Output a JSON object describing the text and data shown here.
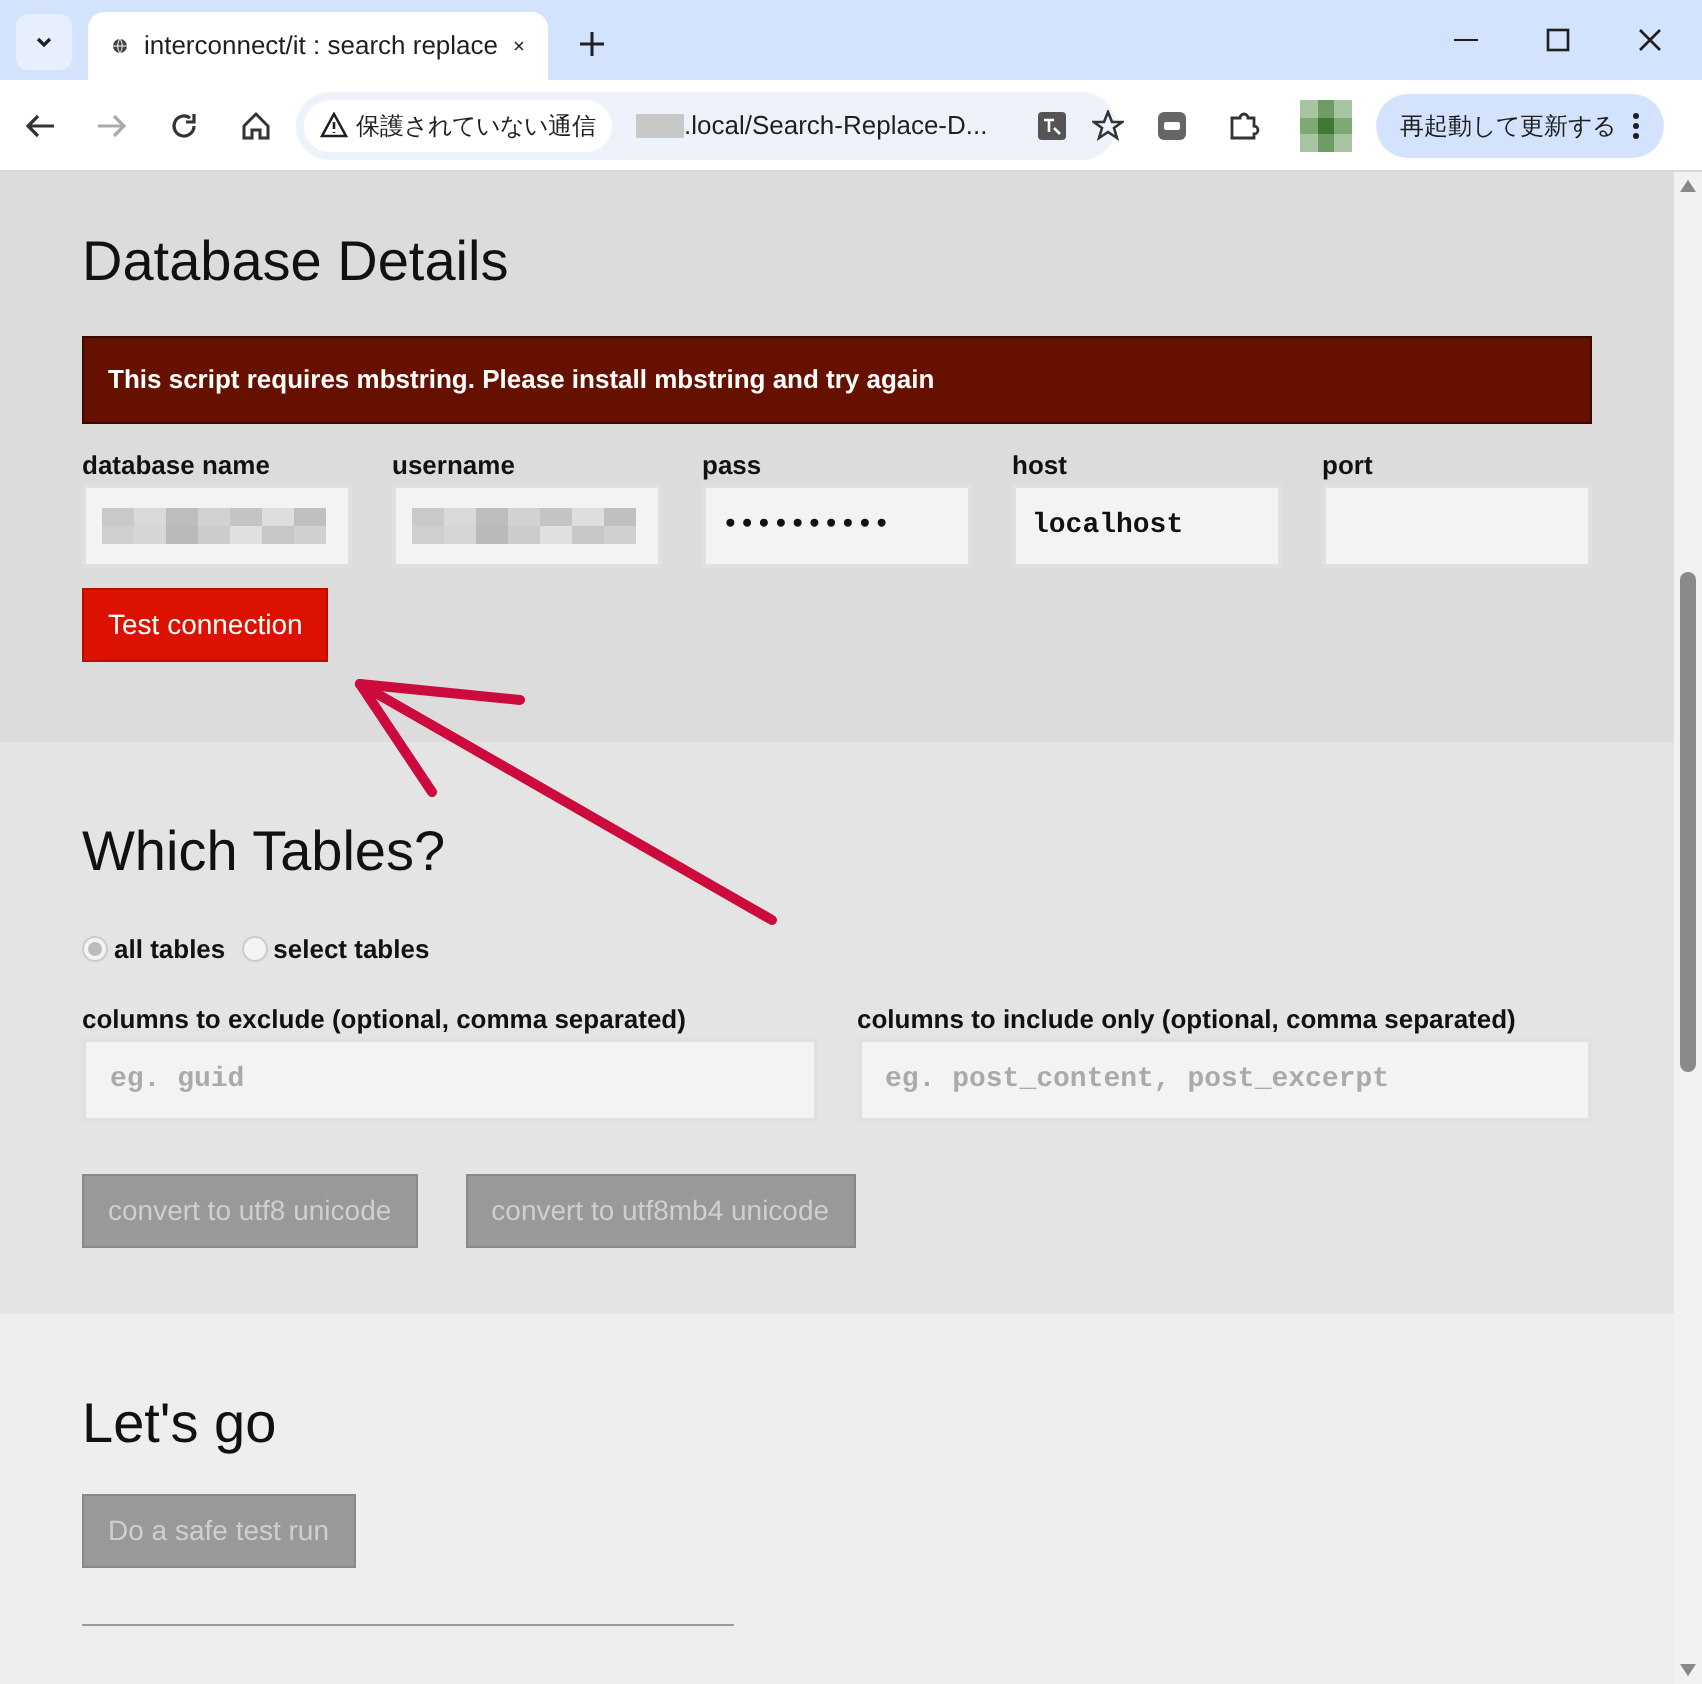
{
  "browser": {
    "tab_title": "interconnect/it : search replace",
    "security_label": "保護されていない通信",
    "url": ".local/Search-Replace-D...",
    "restart_button": "再起動して更新する"
  },
  "database": {
    "title": "Database Details",
    "error": "This script requires mbstring. Please install mbstring and try again",
    "fields": [
      {
        "label": "database name",
        "kind": "blurred"
      },
      {
        "label": "username",
        "kind": "blurred"
      },
      {
        "label": "pass",
        "kind": "text",
        "value": "••••••••••"
      },
      {
        "label": "host",
        "kind": "text",
        "value": "localhost"
      },
      {
        "label": "port",
        "kind": "text"
      }
    ],
    "test_button": {
      "label": "Test connection",
      "disabled": false
    }
  },
  "tables": {
    "title": "Which Tables?",
    "options": [
      {
        "label": "all tables",
        "selected": true
      },
      {
        "label": "select tables",
        "selected": false
      }
    ],
    "columns": [
      {
        "label": "columns to exclude (optional, comma separated)",
        "placeholder": "eg. guid"
      },
      {
        "label": "columns to include only (optional, comma separated)",
        "placeholder": "eg. post_content, post_excerpt"
      }
    ],
    "buttons": [
      {
        "label": "convert to utf8 unicode",
        "disabled": true
      },
      {
        "label": "convert to utf8mb4 unicode",
        "disabled": true
      }
    ]
  },
  "go": {
    "title": "Let's go",
    "button": {
      "label": "Do a safe test run",
      "disabled": true
    }
  }
}
